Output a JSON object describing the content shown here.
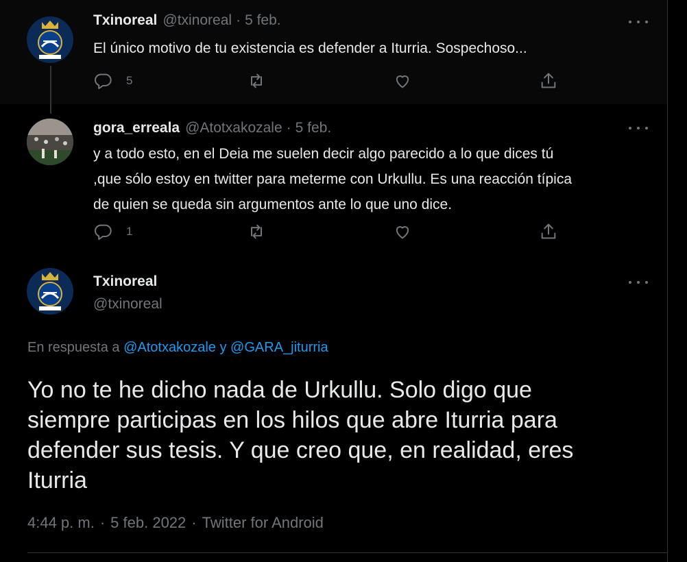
{
  "colors": {
    "background": "#000000",
    "text_primary": "#e7e9ea",
    "text_secondary": "#71767b",
    "link": "#1d9bf0"
  },
  "thread": [
    {
      "display_name": "Txinoreal",
      "handle": "@txinoreal",
      "separator": "·",
      "date": "5 feb.",
      "text": "El único motivo de tu existencia es defender a Iturria. Sospechoso...",
      "avatar_icon": "real-sociedad-crest-avatar",
      "reply_count": "5"
    },
    {
      "display_name": "gora_erreala",
      "handle": "@Atotxakozale",
      "separator": "·",
      "date": "5 feb.",
      "text_lines": [
        "y a todo esto, en el Deia me suelen decir algo parecido a lo que dices tú",
        ",que sólo estoy en twitter para meterme con Urkullu. Es una reacción típica",
        "de quien se queda sin argumentos ante lo que uno dice."
      ],
      "avatar_icon": "stadium-photo-avatar",
      "reply_count": "1"
    }
  ],
  "focused": {
    "display_name": "Txinoreal",
    "handle": "@txinoreal",
    "avatar_icon": "real-sociedad-crest-avatar",
    "reply_prefix": "En respuesta a",
    "reply_to_1": "@Atotxakozale",
    "reply_joiner": "y",
    "reply_to_2": "@GARA_jiturria",
    "text_lines": [
      "Yo no te he dicho nada de Urkullu. Solo digo que",
      "siempre participas en los hilos que abre Iturria para",
      "defender sus tesis.  Y que creo que,  en realidad,  eres",
      "Iturria"
    ],
    "time": "4:44 p. m.",
    "date": "5 feb. 2022",
    "client": "Twitter for Android",
    "separator": "·"
  },
  "icons": {
    "more": "more-dots-icon",
    "reply": "reply-bubble-icon",
    "retweet": "retweet-icon",
    "like": "heart-icon",
    "share": "share-icon"
  }
}
